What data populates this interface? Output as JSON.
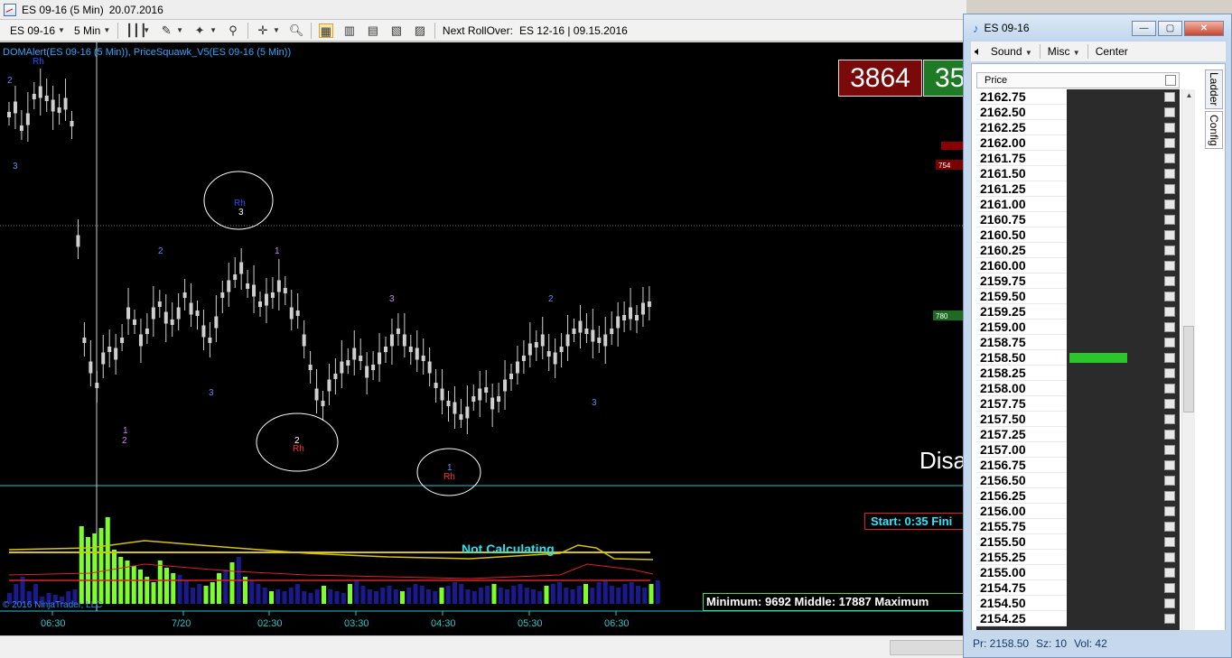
{
  "main": {
    "title": "ES 09-16 (5 Min)",
    "date": "20.07.2016",
    "toolbar": {
      "instrument": "ES 09-16",
      "interval": "5 Min",
      "rollover_label": "Next RollOver:",
      "rollover_value": "ES 12-16 | 09.15.2016"
    },
    "indicator_label": "DOMAlert(ES 09-16 (5 Min)), PriceSquawk_V5(ES 09-16 (5 Min))",
    "box_red": "3864",
    "box_green": "35",
    "disa_text": "Disa",
    "start_text": "Start: 0:35 Fini",
    "not_calculating": "Not Calculating",
    "minmax_text": "Minimum: 9692  Middle: 17887  Maximum",
    "copyright": "© 2016 NinjaTrader, LLC",
    "price_tags": [
      "754",
      "780"
    ],
    "time_labels": [
      "06:30",
      "7/20",
      "02:30",
      "03:30",
      "04:30",
      "05:30",
      "06:30"
    ],
    "markers": [
      {
        "text": "Rh",
        "color": "#2a4fff"
      },
      {
        "text": "2",
        "color": "#5a8fff"
      },
      {
        "text": "3",
        "color": "#5a8fff"
      },
      {
        "text": "Rh",
        "color": "#2a4fff"
      },
      {
        "text": "3",
        "color": "#ffffff"
      },
      {
        "text": "2",
        "color": "#5a8fff"
      },
      {
        "text": "1",
        "color": "#d77cff"
      },
      {
        "text": "3",
        "color": "#5a8fff"
      },
      {
        "text": "1",
        "color": "#d77cff"
      },
      {
        "text": "2",
        "color": "#d77cff"
      },
      {
        "text": "2",
        "color": "#ffffff"
      },
      {
        "text": "Rh",
        "color": "#ff3030"
      },
      {
        "text": "3",
        "color": "#d77cff"
      },
      {
        "text": "1",
        "color": "#5a8fff"
      },
      {
        "text": "Rh",
        "color": "#ff3030"
      },
      {
        "text": "2",
        "color": "#5a8fff"
      },
      {
        "text": "3",
        "color": "#5a8fff"
      }
    ]
  },
  "dom": {
    "title": "ES 09-16",
    "toolbar": {
      "sound": "Sound",
      "misc": "Misc",
      "center": "Center"
    },
    "col_price": "Price",
    "tabs": [
      "Ladder",
      "Config"
    ],
    "ladder_prices": [
      "2162.75",
      "2162.50",
      "2162.25",
      "2162.00",
      "2161.75",
      "2161.50",
      "2161.25",
      "2161.00",
      "2160.75",
      "2160.50",
      "2160.25",
      "2160.00",
      "2159.75",
      "2159.50",
      "2159.25",
      "2159.00",
      "2158.75",
      "2158.50",
      "2158.25",
      "2158.00",
      "2157.75",
      "2157.50",
      "2157.25",
      "2157.00",
      "2156.75",
      "2156.50",
      "2156.25",
      "2156.00",
      "2155.75",
      "2155.50",
      "2155.25",
      "2155.00",
      "2154.75",
      "2154.50",
      "2154.25"
    ],
    "selected_price": "2158.50",
    "status": {
      "pr": "Pr: 2158.50",
      "sz": "Sz: 10",
      "vol": "Vol: 42"
    }
  },
  "colors": {
    "chart_bg": "#000000",
    "candle": "#cfcfcf",
    "volume_green": "#7bff2a",
    "volume_blue": "#1a1a8c",
    "line_yellow": "#d8c400",
    "line_red": "#e02020",
    "cyan_line": "#25c6d0"
  }
}
